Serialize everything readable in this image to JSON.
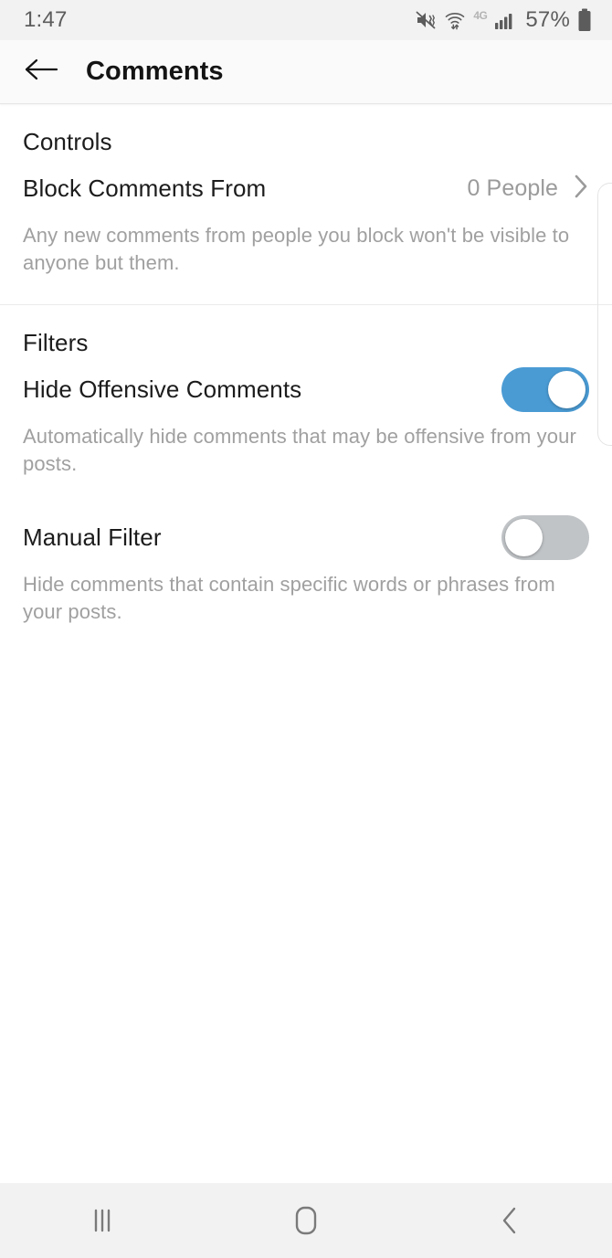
{
  "status_bar": {
    "time": "1:47",
    "battery_percent": "57%",
    "network_label": "4G",
    "icons": [
      "mute-vibrate-icon",
      "wifi-data-transfer-icon",
      "lte-4g-icon",
      "cellular-signal-icon",
      "battery-icon"
    ]
  },
  "header": {
    "back_icon": "arrow-left-icon",
    "title": "Comments"
  },
  "sections": [
    {
      "id": "controls",
      "title": "Controls",
      "rows": [
        {
          "label": "Block Comments From",
          "value": "0 People",
          "chevron_icon": "chevron-right-icon",
          "description": "Any new comments from people you block won't be visible to anyone but them."
        }
      ]
    },
    {
      "id": "filters",
      "title": "Filters",
      "rows": [
        {
          "label": "Hide Offensive Comments",
          "toggle_state": "on",
          "description": "Automatically hide comments that may be offensive from your posts."
        },
        {
          "label": "Manual Filter",
          "toggle_state": "off",
          "description": "Hide comments that contain specific words or phrases from your posts."
        }
      ]
    }
  ],
  "nav_bar": {
    "recents_icon": "recents-icon",
    "home_icon": "home-icon",
    "back_icon": "back-chevron-icon"
  },
  "colors": {
    "toggle_on": "#4a9bd4",
    "toggle_off": "#c1c4c7",
    "primary_text": "#1c1c1c",
    "secondary_text": "#a0a0a0",
    "status_bar_bg": "#f2f2f2"
  }
}
